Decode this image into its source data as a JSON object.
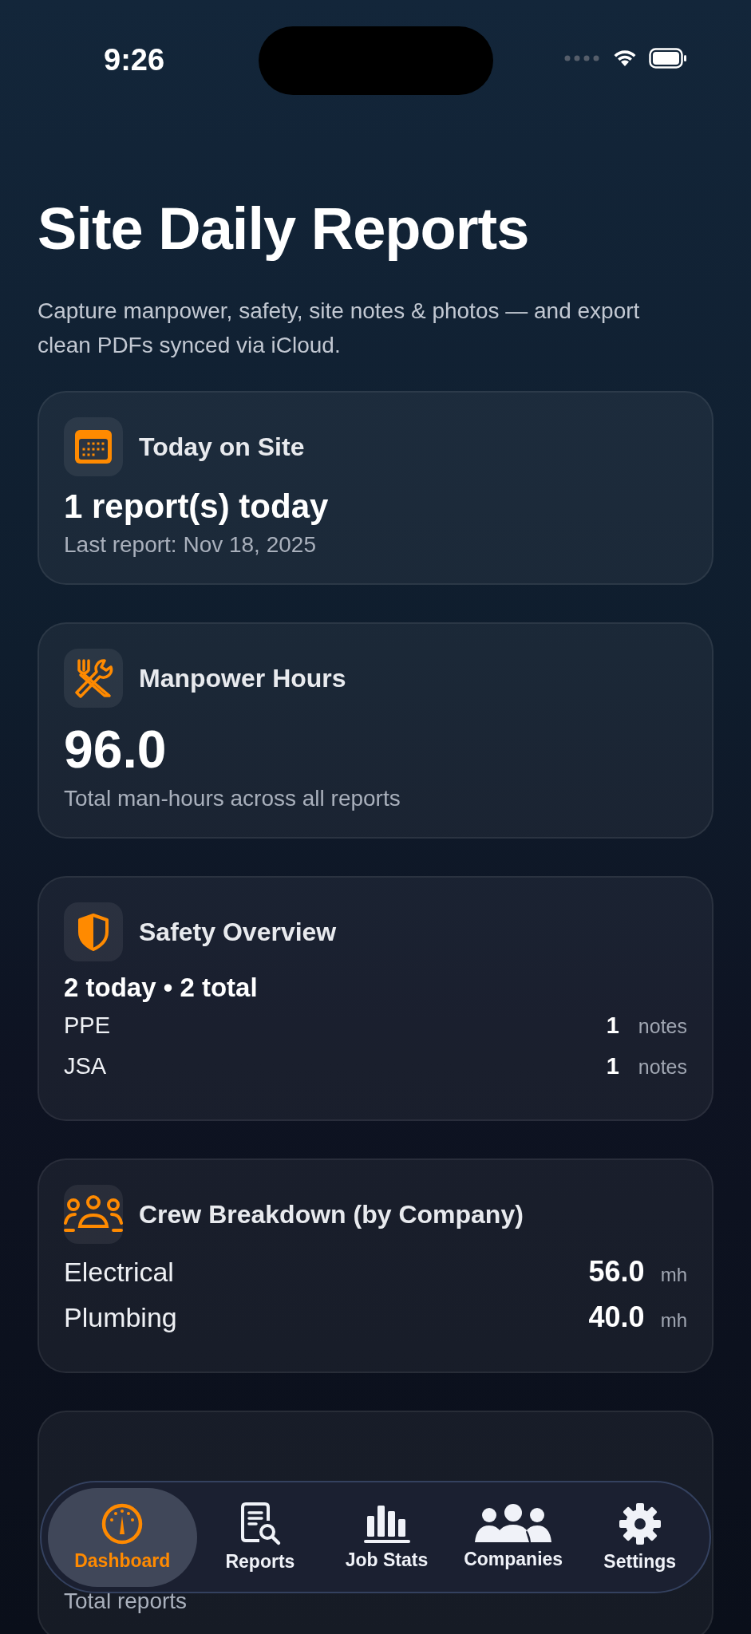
{
  "status_bar": {
    "time": "9:26"
  },
  "header": {
    "title": "Site Daily Reports",
    "subtitle": "Capture manpower, safety, site notes & photos — and export clean PDFs synced via iCloud."
  },
  "cards": [
    {
      "kind": "today",
      "title": "Today on Site",
      "headline": "1 report(s) today",
      "caption": "Last report: Nov 18, 2025"
    },
    {
      "kind": "hours",
      "title": "Manpower Hours",
      "value": "96.0",
      "caption": "Total man-hours across all reports"
    },
    {
      "kind": "safety",
      "title": "Safety Overview",
      "headline": "2 today • 2 total",
      "rows": [
        {
          "label": "PPE",
          "count": "1",
          "unit": "notes"
        },
        {
          "label": "JSA",
          "count": "1",
          "unit": "notes"
        }
      ]
    },
    {
      "kind": "crew",
      "title": "Crew Breakdown (by Company)",
      "rows": [
        {
          "label": "Electrical",
          "count": "56.0",
          "unit": "mh"
        },
        {
          "label": "Plumbing",
          "count": "40.0",
          "unit": "mh"
        }
      ]
    },
    {
      "kind": "overview",
      "caption": "Total reports"
    }
  ],
  "tab_bar": [
    {
      "label": "Dashboard",
      "selected": true
    },
    {
      "label": "Reports",
      "selected": false
    },
    {
      "label": "Job Stats",
      "selected": false
    },
    {
      "label": "Companies",
      "selected": false
    },
    {
      "label": "Settings",
      "selected": false
    }
  ]
}
